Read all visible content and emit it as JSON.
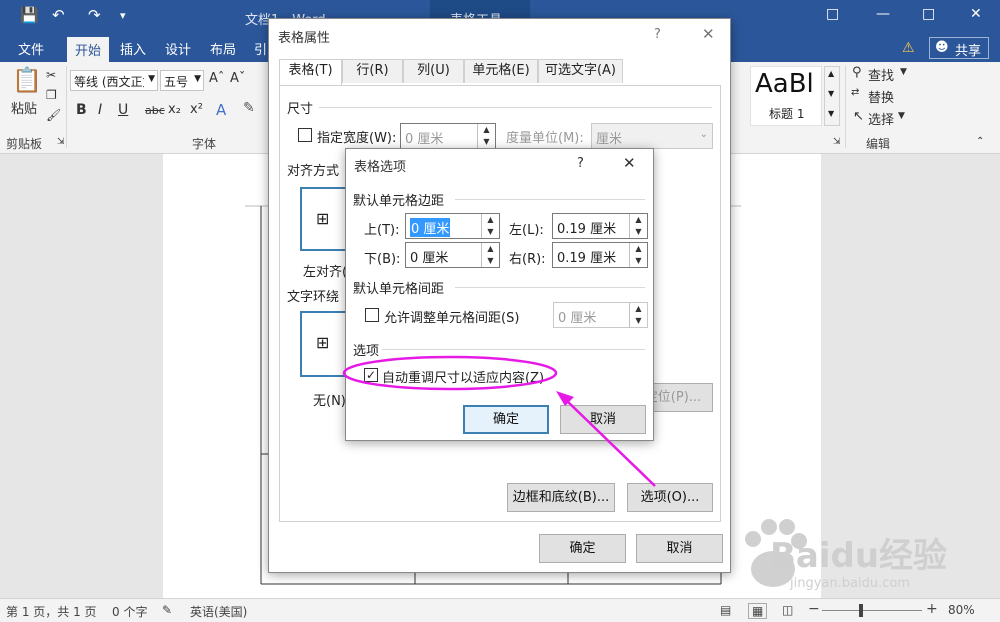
{
  "window": {
    "title": "文档1 - Word",
    "context_tab": "表格工具"
  },
  "ribbon_tabs": [
    "文件",
    "开始",
    "插入",
    "设计",
    "布局",
    "引"
  ],
  "share_label": "共享",
  "ribbon": {
    "paste_label": "粘贴",
    "clipboard_label": "剪贴板",
    "font_name": "等线 (西文正文",
    "font_size": "五号",
    "font_group_label": "字体",
    "style_preview": "AaBl",
    "style_name": "标题 1",
    "find_label": "查找",
    "replace_label": "替换",
    "select_label": "选择",
    "edit_group_label": "编辑"
  },
  "table_props": {
    "title": "表格属性",
    "help": "?",
    "tabs": [
      "表格(T)",
      "行(R)",
      "列(U)",
      "单元格(E)",
      "可选文字(A)"
    ],
    "size_section": "尺寸",
    "pref_width_label": "指定宽度(W):",
    "pref_width_value": "0 厘米",
    "measure_label": "度量单位(M):",
    "measure_value": "厘米",
    "align_section": "对齐方式",
    "align_left": "左对齐(",
    "wrap_section": "文字环绕",
    "wrap_none": "无(N)",
    "position_btn": "定位(P)...",
    "borders_btn": "边框和底纹(B)...",
    "options_btn": "选项(O)...",
    "ok_btn": "确定",
    "cancel_btn": "取消"
  },
  "table_options": {
    "title": "表格选项",
    "help": "?",
    "margins_section": "默认单元格边距",
    "top_label": "上(T):",
    "top_value": "0 厘米",
    "left_label": "左(L):",
    "left_value": "0.19 厘米",
    "bottom_label": "下(B):",
    "bottom_value": "0 厘米",
    "right_label": "右(R):",
    "right_value": "0.19 厘米",
    "spacing_section": "默认单元格间距",
    "allow_spacing_label": "允许调整单元格间距(S)",
    "spacing_value": "0 厘米",
    "options_section": "选项",
    "autofit_label": "自动重调尺寸以适应内容(Z)",
    "autofit_checked": true,
    "ok_btn": "确定",
    "cancel_btn": "取消"
  },
  "status": {
    "page": "第 1 页，共 1 页",
    "words": "0 个字",
    "language": "英语(美国)",
    "zoom": "80%",
    "zoom_level": 0.8
  },
  "watermark": {
    "brand": "Baidu经验",
    "url": "jingyan.baidu.com"
  },
  "colors": {
    "word_blue": "#2b579a",
    "highlight": "#e619e6",
    "focus_blue": "#3c7fb1"
  }
}
